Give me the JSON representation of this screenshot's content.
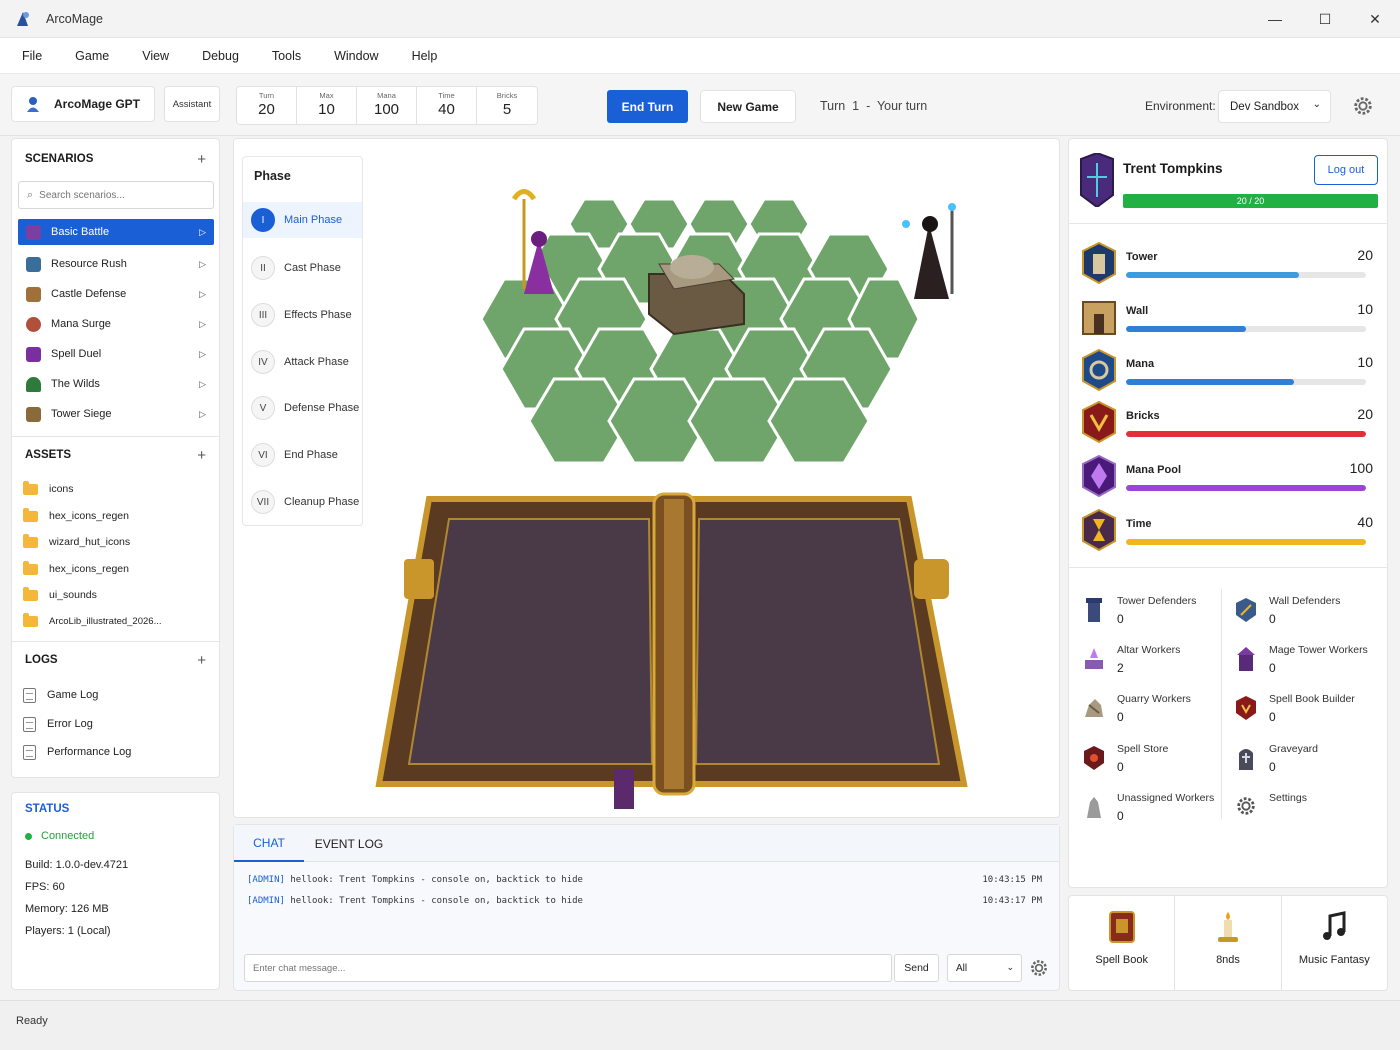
{
  "window": {
    "title": "ArcoMage",
    "controls": [
      "—",
      "☐",
      "✕"
    ]
  },
  "menu": [
    "File",
    "Game",
    "View",
    "Debug",
    "Tools",
    "Window",
    "Help"
  ],
  "toolbar": {
    "gpt_label": "ArcoMage GPT",
    "assistant_label": "Assistant",
    "stats": [
      {
        "label": "Turn",
        "value": "20"
      },
      {
        "label": "Max",
        "value": "10"
      },
      {
        "label": "Mana",
        "value": "100"
      },
      {
        "label": "Time",
        "value": "40"
      },
      {
        "label": "Bricks",
        "value": "5"
      }
    ],
    "end_turn": "End Turn",
    "new_game": "New Game",
    "turn_status": "Turn  1  -  Your turn",
    "environment_label": "Environment:",
    "environment_value": "Dev Sandbox"
  },
  "sidebar": {
    "scenarios_title": "SCENARIOS",
    "search_placeholder": "Search scenarios...",
    "scenarios": [
      {
        "label": "Basic Battle",
        "color": "#7a3fa0",
        "active": true
      },
      {
        "label": "Resource Rush",
        "color": "#3a6e9a"
      },
      {
        "label": "Castle Defense",
        "color": "#a0703a"
      },
      {
        "label": "Mana Surge",
        "color": "#b0503a"
      },
      {
        "label": "Spell Duel",
        "color": "#7a2fa0"
      },
      {
        "label": "The Wilds",
        "color": "#2e7a3a"
      },
      {
        "label": "Tower Siege",
        "color": "#8a6a3a"
      }
    ],
    "assets_title": "ASSETS",
    "assets": [
      "icons",
      "hex_icons_regen",
      "wizard_hut_icons",
      "hex_icons_regen",
      "ui_sounds",
      "ArcoLib_illustrated_2026..."
    ],
    "logs_title": "LOGS",
    "logs": [
      "Game Log",
      "Error Log",
      "Performance Log"
    ]
  },
  "status": {
    "title": "STATUS",
    "connection": "Connected",
    "build": "Build:  1.0.0-dev.4721",
    "fps": "FPS:  60",
    "memory": "Memory:  126 MB",
    "players": "Players:  1  (Local)"
  },
  "phase": {
    "title": "Phase",
    "items": [
      {
        "num": "I",
        "label": "Main Phase",
        "active": true
      },
      {
        "num": "II",
        "label": "Cast Phase"
      },
      {
        "num": "III",
        "label": "Effects Phase"
      },
      {
        "num": "IV",
        "label": "Attack Phase"
      },
      {
        "num": "V",
        "label": "Defense Phase"
      },
      {
        "num": "VI",
        "label": "End Phase"
      },
      {
        "num": "VII",
        "label": "Cleanup Phase"
      }
    ]
  },
  "chat": {
    "tabs": [
      "CHAT",
      "EVENT LOG"
    ],
    "messages": [
      {
        "tag": "[ADMIN]",
        "text": " hellook: Trent Tompkins - console on, backtick to hide",
        "time": "10:43:15 PM"
      },
      {
        "tag": "[ADMIN]",
        "text": " hellook: Trent Tompkins - console on, backtick to hide",
        "time": "10:43:17 PM"
      }
    ],
    "input_placeholder": "Enter chat message...",
    "send": "Send",
    "filter": "All"
  },
  "player": {
    "name": "Trent Tompkins",
    "logout": "Log out",
    "hp": "20 / 20",
    "hp_fraction": 1.0,
    "resources": [
      {
        "label": "Tower",
        "value": "20",
        "fill": 0.72,
        "color": "#3d9be0",
        "icon": "tower-icon"
      },
      {
        "label": "Wall",
        "value": "10",
        "fill": 0.5,
        "color": "#2f7fd6",
        "icon": "wall-icon"
      },
      {
        "label": "Mana",
        "value": "10",
        "fill": 0.7,
        "color": "#2f7fd6",
        "icon": "mana-icon"
      },
      {
        "label": "Bricks",
        "value": "20",
        "fill": 1.0,
        "color": "#e0303a",
        "icon": "bricks-icon"
      },
      {
        "label": "Mana Pool",
        "value": "100",
        "fill": 1.0,
        "color": "#9a45d8",
        "icon": "mana-pool-icon"
      },
      {
        "label": "Time",
        "value": "40",
        "fill": 1.0,
        "color": "#f0b61e",
        "icon": "time-icon"
      }
    ],
    "workers": [
      {
        "label": "Tower Defenders",
        "value": "0"
      },
      {
        "label": "Wall Defenders",
        "value": "0"
      },
      {
        "label": "Altar Workers",
        "value": "2"
      },
      {
        "label": "Mage Tower Workers",
        "value": "0"
      },
      {
        "label": "Quarry Workers",
        "value": "0"
      },
      {
        "label": "Spell Book Builder",
        "value": "0"
      },
      {
        "label": "Spell Store",
        "value": "0"
      },
      {
        "label": "Graveyard",
        "value": "0"
      },
      {
        "label": "Unassigned Workers",
        "value": "0"
      },
      {
        "label": "Settings",
        "value": ""
      }
    ]
  },
  "quick": [
    "Spell Book",
    "8nds",
    "Music Fantasy"
  ],
  "statusbar": "Ready"
}
